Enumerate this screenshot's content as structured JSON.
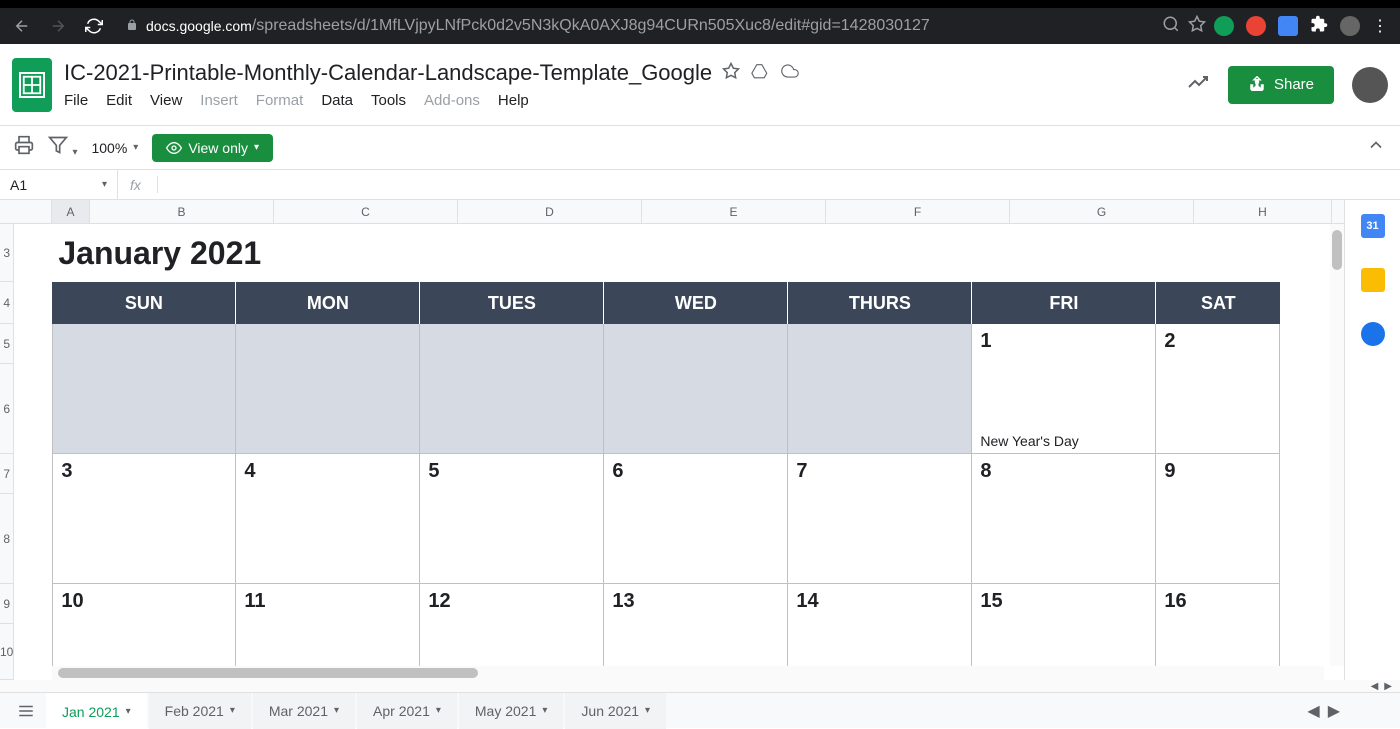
{
  "browser": {
    "url_host": "docs.google.com",
    "url_path": "/spreadsheets/d/1MfLVjpyLNfPck0d2v5N3kQkA0AXJ8g94CURn505Xuc8/edit#gid=1428030127"
  },
  "doc": {
    "title": "IC-2021-Printable-Monthly-Calendar-Landscape-Template_Google",
    "menus": [
      "File",
      "Edit",
      "View",
      "Insert",
      "Format",
      "Data",
      "Tools",
      "Add-ons",
      "Help"
    ],
    "disabled_menus": [
      "Insert",
      "Format",
      "Add-ons"
    ],
    "share_label": "Share"
  },
  "toolbar": {
    "zoom": "100%",
    "view_only": "View only"
  },
  "formula": {
    "name_box": "A1"
  },
  "columns": [
    "A",
    "B",
    "C",
    "D",
    "E",
    "F",
    "G",
    "H"
  ],
  "rows": [
    "3",
    "4",
    "5",
    "6",
    "7",
    "8",
    "9",
    "10"
  ],
  "calendar": {
    "title": "January 2021",
    "day_headers": [
      "SUN",
      "MON",
      "TUES",
      "WED",
      "THURS",
      "FRI",
      "SAT"
    ],
    "weeks": [
      {
        "cells": [
          {
            "date": "",
            "inactive": true
          },
          {
            "date": "",
            "inactive": true
          },
          {
            "date": "",
            "inactive": true
          },
          {
            "date": "",
            "inactive": true
          },
          {
            "date": "",
            "inactive": true
          },
          {
            "date": "1",
            "event": "New Year's Day"
          },
          {
            "date": "2"
          }
        ]
      },
      {
        "cells": [
          {
            "date": "3"
          },
          {
            "date": "4"
          },
          {
            "date": "5"
          },
          {
            "date": "6"
          },
          {
            "date": "7"
          },
          {
            "date": "8"
          },
          {
            "date": "9"
          }
        ]
      },
      {
        "cells": [
          {
            "date": "10"
          },
          {
            "date": "11"
          },
          {
            "date": "12"
          },
          {
            "date": "13"
          },
          {
            "date": "14"
          },
          {
            "date": "15"
          },
          {
            "date": "16"
          }
        ]
      }
    ]
  },
  "tabs": [
    "Jan 2021",
    "Feb 2021",
    "Mar 2021",
    "Apr 2021",
    "May 2021",
    "Jun 2021"
  ],
  "active_tab": "Jan 2021"
}
